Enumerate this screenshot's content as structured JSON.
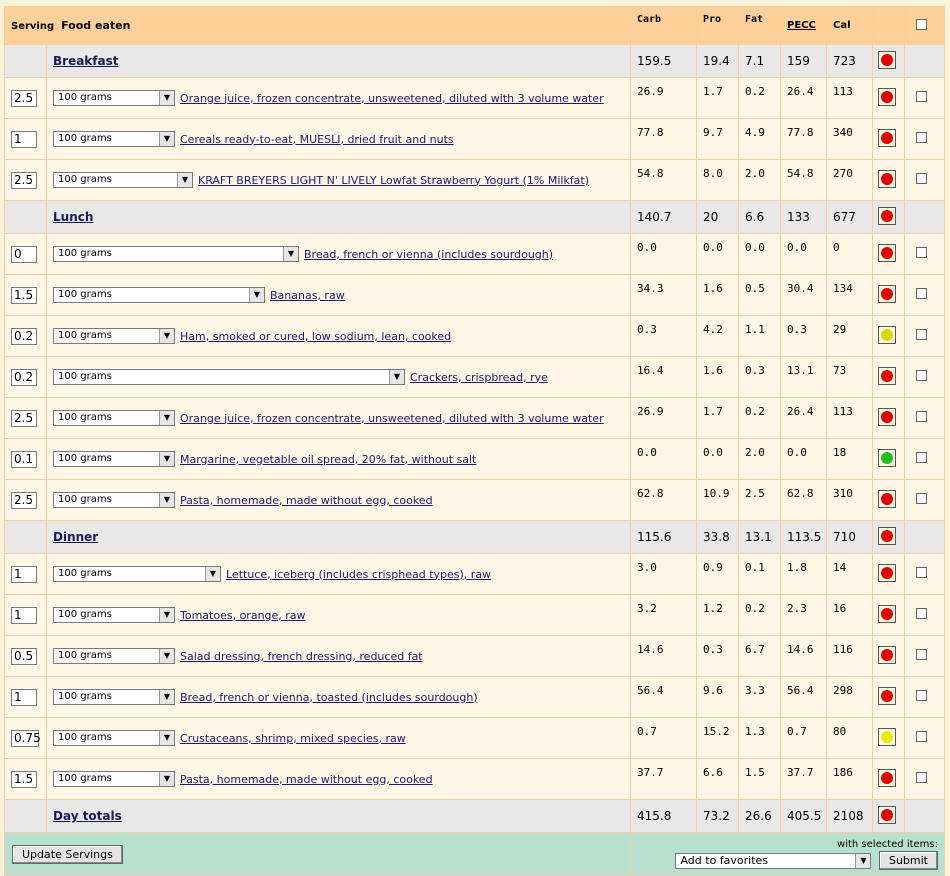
{
  "headers": {
    "serving": "Serving",
    "food": "Food eaten",
    "carb": "Carb",
    "pro": "Pro",
    "fat": "Fat",
    "pecc": "PECC",
    "cal": "Cal"
  },
  "unit": "100 grams",
  "rows": [
    {
      "type": "meal",
      "name": "Breakfast",
      "carb": "159.5",
      "pro": "19.4",
      "fat": "7.1",
      "pecc": "159",
      "cal": "723",
      "pie": "#e00000"
    },
    {
      "type": "food",
      "serving": "2.5",
      "food": "Orange juice, frozen concentrate, unsweetened, diluted with 3 volume water",
      "sel_w": 122,
      "carb": "26.9",
      "pro": "1.7",
      "fat": "0.2",
      "pecc": "26.4",
      "cal": "113",
      "pie": "#e00000"
    },
    {
      "type": "food",
      "serving": "1",
      "food": "Cereals ready-to-eat, MUESLI, dried fruit and nuts",
      "sel_w": 122,
      "carb": "77.8",
      "pro": "9.7",
      "fat": "4.9",
      "pecc": "77.8",
      "cal": "340",
      "pie": "#e00000"
    },
    {
      "type": "food",
      "serving": "2.5",
      "food": "KRAFT BREYERS LIGHT N' LIVELY Lowfat Strawberry Yogurt (1% Milkfat)",
      "sel_w": 140,
      "carb": "54.8",
      "pro": "8.0",
      "fat": "2.0",
      "pecc": "54.8",
      "cal": "270",
      "pie": "#e00000"
    },
    {
      "type": "meal",
      "name": "Lunch",
      "carb": "140.7",
      "pro": "20",
      "fat": "6.6",
      "pecc": "133",
      "cal": "677",
      "pie": "#e00000"
    },
    {
      "type": "food",
      "serving": "0",
      "food": "Bread, french or vienna (includes sourdough)",
      "sel_w": 246,
      "carb": "0.0",
      "pro": "0.0",
      "fat": "0.0",
      "pecc": "0.0",
      "cal": "0",
      "pie": "#e00000"
    },
    {
      "type": "food",
      "serving": "1.5",
      "food": "Bananas, raw",
      "sel_w": 212,
      "carb": "34.3",
      "pro": "1.6",
      "fat": "0.5",
      "pecc": "30.4",
      "cal": "134",
      "pie": "#e00000"
    },
    {
      "type": "food",
      "serving": "0.2",
      "food": "Ham, smoked or cured, low sodium, lean, cooked",
      "sel_w": 122,
      "carb": "0.3",
      "pro": "4.2",
      "fat": "1.1",
      "pecc": "0.3",
      "cal": "29",
      "pie": "#d8d800"
    },
    {
      "type": "food",
      "serving": "0.2",
      "food": "Crackers, crispbread, rye",
      "sel_w": 352,
      "carb": "16.4",
      "pro": "1.6",
      "fat": "0.3",
      "pecc": "13.1",
      "cal": "73",
      "pie": "#e00000"
    },
    {
      "type": "food",
      "serving": "2.5",
      "food": "Orange juice, frozen concentrate, unsweetened, diluted with 3 volume water",
      "sel_w": 122,
      "carb": "26.9",
      "pro": "1.7",
      "fat": "0.2",
      "pecc": "26.4",
      "cal": "113",
      "pie": "#e00000"
    },
    {
      "type": "food",
      "serving": "0.1",
      "food": "Margarine, vegetable oil spread, 20% fat, without salt",
      "sel_w": 122,
      "carb": "0.0",
      "pro": "0.0",
      "fat": "2.0",
      "pecc": "0.0",
      "cal": "18",
      "pie": "#20c020"
    },
    {
      "type": "food",
      "serving": "2.5",
      "food": "Pasta, homemade, made without egg, cooked",
      "sel_w": 122,
      "carb": "62.8",
      "pro": "10.9",
      "fat": "2.5",
      "pecc": "62.8",
      "cal": "310",
      "pie": "#e00000"
    },
    {
      "type": "meal",
      "name": "Dinner",
      "carb": "115.6",
      "pro": "33.8",
      "fat": "13.1",
      "pecc": "113.5",
      "cal": "710",
      "pie": "#e00000"
    },
    {
      "type": "food",
      "serving": "1",
      "food": "Lettuce, iceberg (includes crisphead types), raw",
      "sel_w": 168,
      "carb": "3.0",
      "pro": "0.9",
      "fat": "0.1",
      "pecc": "1.8",
      "cal": "14",
      "pie": "#e00000"
    },
    {
      "type": "food",
      "serving": "1",
      "food": "Tomatoes, orange, raw",
      "sel_w": 122,
      "carb": "3.2",
      "pro": "1.2",
      "fat": "0.2",
      "pecc": "2.3",
      "cal": "16",
      "pie": "#e00000"
    },
    {
      "type": "food",
      "serving": "0.5",
      "food": "Salad dressing, french dressing, reduced fat",
      "sel_w": 122,
      "carb": "14.6",
      "pro": "0.3",
      "fat": "6.7",
      "pecc": "14.6",
      "cal": "116",
      "pie": "#e00000"
    },
    {
      "type": "food",
      "serving": "1",
      "food": "Bread, french or vienna, toasted (includes sourdough)",
      "sel_w": 122,
      "carb": "56.4",
      "pro": "9.6",
      "fat": "3.3",
      "pecc": "56.4",
      "cal": "298",
      "pie": "#e00000"
    },
    {
      "type": "food",
      "serving": "0.75",
      "food": "Crustaceans, shrimp, mixed species, raw",
      "sel_w": 122,
      "carb": "0.7",
      "pro": "15.2",
      "fat": "1.3",
      "pecc": "0.7",
      "cal": "80",
      "pie": "#e8e800"
    },
    {
      "type": "food",
      "serving": "1.5",
      "food": "Pasta, homemade, made without egg, cooked",
      "sel_w": 122,
      "carb": "37.7",
      "pro": "6.6",
      "fat": "1.5",
      "pecc": "37.7",
      "cal": "186",
      "pie": "#e00000"
    },
    {
      "type": "meal",
      "name": "Day totals",
      "carb": "415.8",
      "pro": "73.2",
      "fat": "26.6",
      "pecc": "405.5",
      "cal": "2108",
      "pie": "#e00000"
    }
  ],
  "footer": {
    "update_button": "Update Servings",
    "with_selected": "with selected items:",
    "action_value": "Add to favorites",
    "submit_button": "Submit"
  }
}
